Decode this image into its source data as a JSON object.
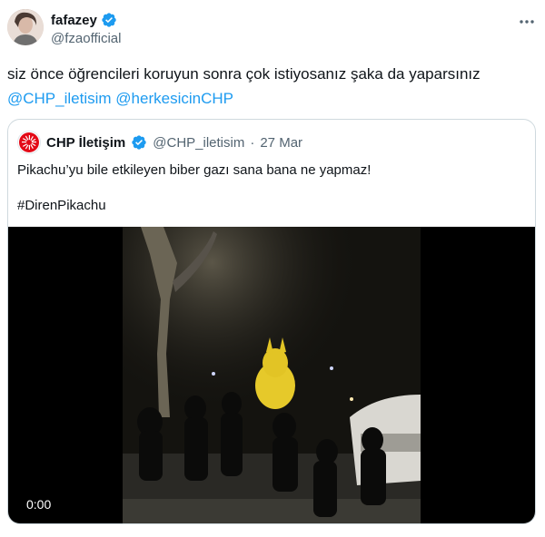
{
  "author": {
    "display_name": "fafazey",
    "handle": "@fzaofficial"
  },
  "tweet": {
    "text": "siz önce öğrencileri koruyun sonra çok istiyosanız şaka da yaparsınız",
    "mentions": [
      "@CHP_iletisim",
      "@herkesicinCHP"
    ]
  },
  "quote": {
    "display_name": "CHP İletişim",
    "handle": "@CHP_iletisim",
    "separator": "·",
    "date": "27 Mar",
    "text": "Pikachu’yu bile etkileyen biber gazı sana bana ne yapmaz!",
    "hashtag": "#DirenPikachu",
    "video_time": "0:00"
  },
  "icons": {
    "verified": "verified-badge-icon",
    "more": "more-options-icon",
    "chp_logo": "chp-logo-icon"
  },
  "colors": {
    "link": "#1d9bf0",
    "verified": "#1d9bf0",
    "secondary_text": "#536471"
  }
}
